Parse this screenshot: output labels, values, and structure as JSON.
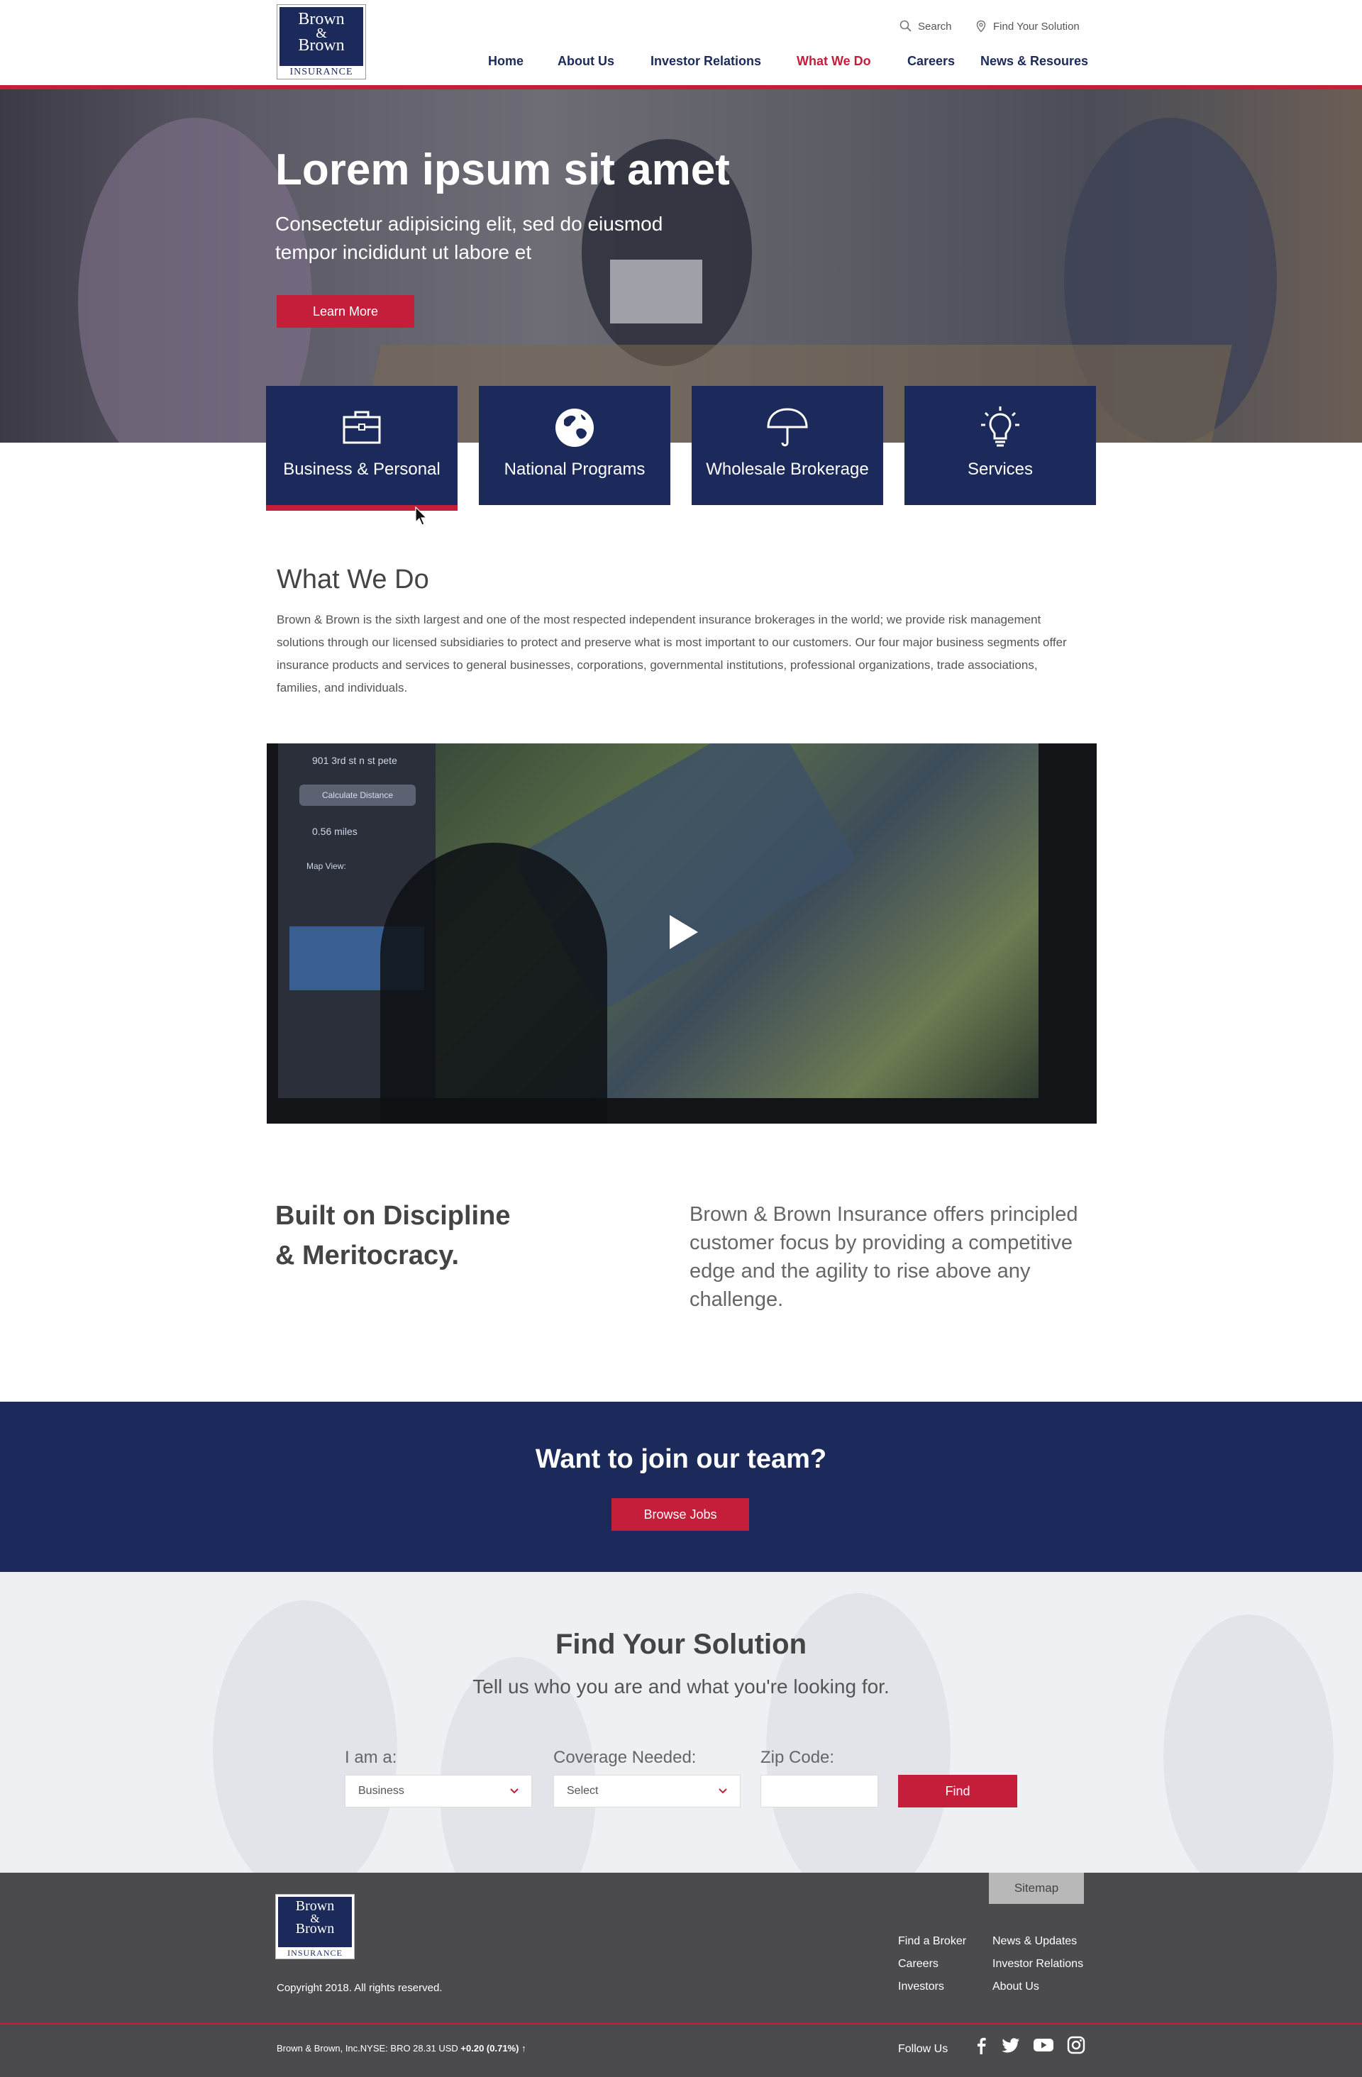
{
  "header": {
    "logo": {
      "line1": "Brown",
      "line2": "&",
      "line3": "Brown",
      "line4": "INSURANCE"
    },
    "utility": {
      "search_label": "Search",
      "find_label": "Find Your Solution"
    },
    "nav": [
      {
        "label": "Home"
      },
      {
        "label": "About Us"
      },
      {
        "label": "Investor Relations"
      },
      {
        "label": "What We Do",
        "active": true
      },
      {
        "label": "Careers"
      },
      {
        "label": "News & Resoures"
      }
    ]
  },
  "hero": {
    "title": "Lorem ipsum sit amet",
    "subtitle": "Consectetur adipisicing elit, sed do eiusmod tempor incididunt ut labore et",
    "button_label": "Learn More"
  },
  "tiles": [
    {
      "label": "Business & Personal",
      "icon": "briefcase-icon",
      "selected": true
    },
    {
      "label": "National Programs",
      "icon": "globe-icon"
    },
    {
      "label": "Wholesale Brokerage",
      "icon": "umbrella-icon"
    },
    {
      "label": "Services",
      "icon": "lightbulb-icon"
    }
  ],
  "what_we_do": {
    "title": "What We Do",
    "body": "Brown & Brown is the sixth largest and one of the most respected independent insurance brokerages in the world; we provide risk management solutions through our licensed subsidiaries to protect and preserve what is most important to our customers. Our four major business segments offer insurance products and services to general businesses, corporations, governmental institutions, professional organizations, trade associations, families, and individuals."
  },
  "video": {
    "screen_text": {
      "address": "901 3rd st n st pete",
      "calc": "Calculate Distance",
      "distance": "0.56 miles",
      "map_view": "Map View:"
    }
  },
  "discipline": {
    "title_line1": "Built on Discipline",
    "title_line2": "& Meritocracy.",
    "body": "Brown & Brown Insurance offers principled customer focus by providing a competitive edge and the agility to rise above any challenge."
  },
  "join": {
    "title": "Want to join our team?",
    "button_label": "Browse Jobs"
  },
  "find": {
    "title": "Find Your Solution",
    "subtitle": "Tell us who you are and what you're looking for.",
    "iam_label": "I am a:",
    "iam_value": "Business",
    "coverage_label": "Coverage Needed:",
    "coverage_value": "Select",
    "zip_label": "Zip Code:",
    "zip_value": "",
    "button_label": "Find"
  },
  "footer": {
    "sitemap_label": "Sitemap",
    "copyright": "Copyright 2018. All rights reserved.",
    "links_col1": [
      "Find a Broker",
      "Careers",
      "Investors"
    ],
    "links_col2": [
      "News & Updates",
      "Investor Relations",
      "About Us"
    ],
    "ticker_prefix": "Brown & Brown, Inc.NYSE: BRO 28.31 USD",
    "ticker_change": "+0.20 (0.71%)",
    "follow_label": "Follow Us"
  },
  "colors": {
    "navy": "#1b2a5a",
    "red": "#c41e3a",
    "footer": "#4b4b4d"
  }
}
